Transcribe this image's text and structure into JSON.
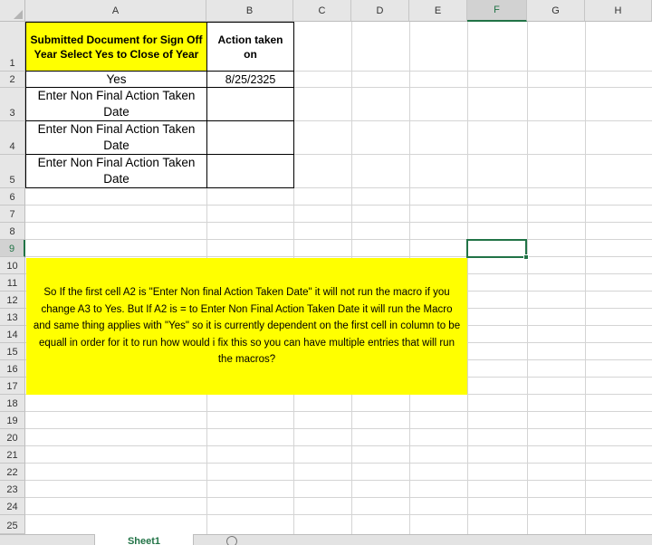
{
  "columns": [
    "A",
    "B",
    "C",
    "D",
    "E",
    "F",
    "G",
    "H"
  ],
  "selected_column": "F",
  "rows": [
    "1",
    "2",
    "3",
    "4",
    "5",
    "6",
    "7",
    "8",
    "9",
    "10",
    "11",
    "12",
    "13",
    "14",
    "15",
    "16",
    "17",
    "18",
    "19",
    "20",
    "21",
    "22",
    "23",
    "24",
    "25"
  ],
  "selected_row": "9",
  "cells": {
    "A1": "Submitted Document for Sign Off Year Select Yes to Close of Year",
    "B1": "Action taken on",
    "A2": "Yes",
    "B2": "8/25/2325",
    "A3": "Enter Non Final Action Taken Date",
    "A4": "Enter Non Final Action Taken Date",
    "A5": "Enter Non Final Action Taken Date"
  },
  "note_text": "So If the first cell A2 is \"Enter Non final Action Taken Date\" it will not run the macro if you change A3 to Yes. But If A2 is = to Enter Non Final Action Taken Date it will run the Macro and same thing applies with \"Yes\" so it is currently dependent on the first cell in column to be equall in order for it to run how would i fix this so you can have multiple entries that will run the macros?",
  "sheet_tab": "Sheet1",
  "colors": {
    "highlight": "#ffff00",
    "excel_green": "#217346"
  }
}
